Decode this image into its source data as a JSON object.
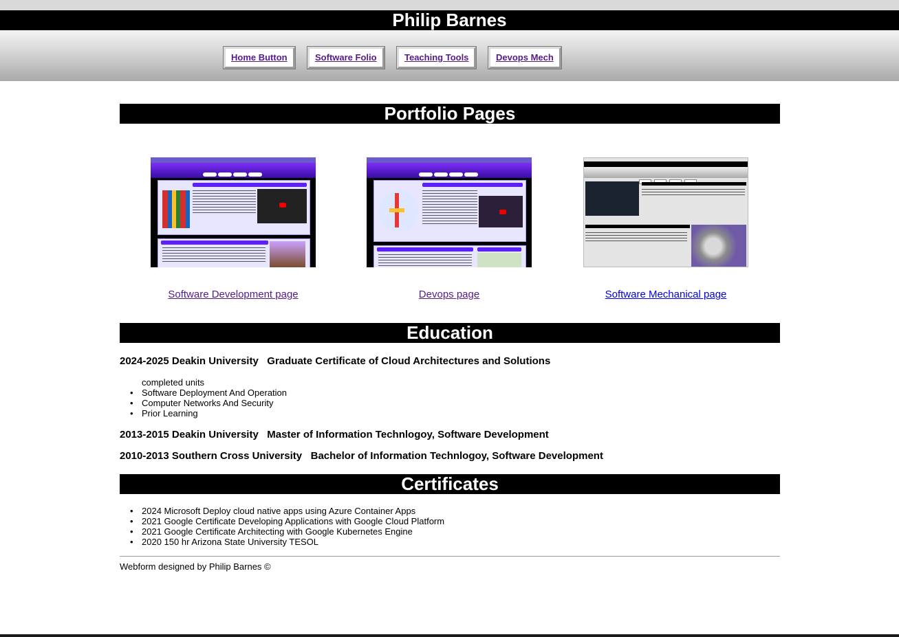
{
  "header": {
    "title": "Philip Barnes"
  },
  "nav": [
    {
      "label": "Home Button"
    },
    {
      "label": "Software Folio"
    },
    {
      "label": "Teaching Tools"
    },
    {
      "label": "Devops Mech"
    }
  ],
  "portfolio": {
    "heading": "Portfolio Pages",
    "items": [
      {
        "link": "Software Development page",
        "link_color": "#551a8b"
      },
      {
        "link": "Devops page",
        "link_color": "#551a8b"
      },
      {
        "link": "Software Mechanical page",
        "link_color": "#0000ee"
      }
    ]
  },
  "education": {
    "heading": "Education",
    "entries": [
      {
        "title": "2024-2025 Deakin University   Graduate Certificate of Cloud Architectures and Solutions",
        "intro": "completed units",
        "units": [
          "Software Deployment And Operation",
          "Computer Networks And Security",
          "Prior Learning"
        ]
      },
      {
        "title": "2013-2015 Deakin University   Master of Information Technlogoy, Software Development"
      },
      {
        "title": "2010-2013 Southern Cross University   Bachelor of Information Technlogoy, Software Development"
      }
    ]
  },
  "certificates": {
    "heading": "Certificates",
    "items": [
      "2024 Microsoft Deploy cloud native apps using Azure Container Apps",
      "2021 Google Certificate Developing Applications with Google Cloud Platform",
      "2021 Google Certificate Architecting with Google Kubernetes Engine",
      "2020 150 hr Arizona State University TESOL"
    ]
  },
  "footer": {
    "text": "Webform designed by Philip Barnes ©"
  },
  "colors": {
    "visited_link": "#551a8b",
    "link": "#0000ee",
    "bar": "#000000"
  }
}
